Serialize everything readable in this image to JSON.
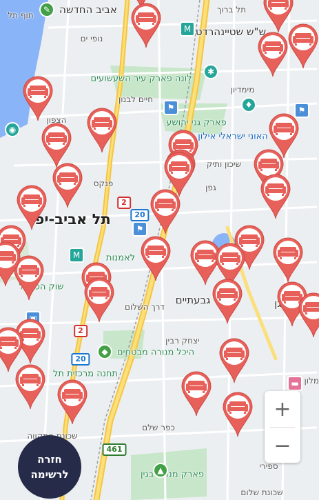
{
  "labels": {
    "beach": "חוף תל",
    "hahadasha": "אביב החדשה",
    "nofei_yam": "נופי ים",
    "tel_baruch": "תל ברוך",
    "shtein": "ש\"ש שטיינהרדט",
    "luna_park": "לונה פארק עיר השעשועים",
    "haim_levanon": "חיים לבנון",
    "mimadyon": "מימדיון",
    "hatzafon": "הצפון",
    "ganei_yehoshua": "פארק גני יהושע",
    "israeli": "האוני ישראלי אילון",
    "shikun": "שיכון ותיק",
    "gefen": "גפן",
    "pinkas": "פנקס",
    "tel_aviv_yafo": "תל אביב-יפו",
    "lealmanut": "לאמנות",
    "givatayim": "גבעתיים",
    "ramat_gan": "רמת גן",
    "shuk_carmel": "שוק הכרמל",
    "hashalom": "דרך השלום",
    "yitzhak_rabin": "יצחק רבין",
    "menorah": "היכל מנורה מבטחים",
    "central_station": "תחנה מרכזית תל",
    "hatikva": "שכונת התקווה",
    "kfar_shalem": "כפר שלם",
    "menachem_begin": "פארק מנחם בגין",
    "sapiri": "ספירי",
    "neve_shalom": "שכונת שלום",
    "hotel": "מלון כפר",
    "north_label": "צפון"
  },
  "routes": [
    "2",
    "20",
    "2",
    "20",
    "461"
  ],
  "pin_icon": "sofa-icon",
  "pin_color": "#e8605a",
  "controls": {
    "zoom_in": "+",
    "zoom_out": "−"
  },
  "back_button": {
    "line1": "חזרה",
    "line2": "לרשימה"
  }
}
